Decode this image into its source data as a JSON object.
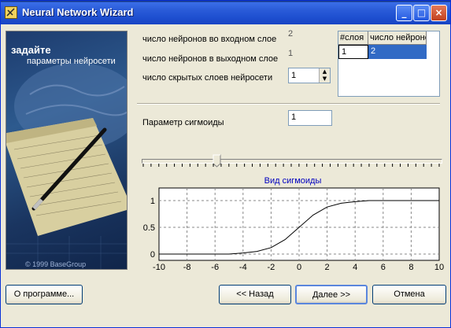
{
  "window": {
    "title": "Neural Network Wizard",
    "buttons": [
      "_",
      "□",
      "×"
    ]
  },
  "side_panel": {
    "heading": "задайте",
    "subheading": "параметры нейросети",
    "copyright": "© 1999 BaseGroup"
  },
  "params": {
    "input_label": "число нейронов во входном слое",
    "input_value": "2",
    "output_label": "число нейронов в выходном слое",
    "output_value": "1",
    "hidden_label": "число скрытых слоев нейросети",
    "hidden_value": "1"
  },
  "layers_table": {
    "headers": [
      "#слоя",
      "число нейроно"
    ],
    "rows": [
      [
        "1",
        "2"
      ]
    ]
  },
  "sigmoid": {
    "label": "Параметр сигмоиды",
    "value": "1"
  },
  "slider": {
    "tick_count": 38,
    "value_fraction": 0.25
  },
  "chart_data": {
    "type": "line",
    "title": "Вид сигмоиды",
    "xlim": [
      -10,
      10
    ],
    "ylim": [
      0,
      1
    ],
    "x_ticks": [
      "-10",
      "-8",
      "-6",
      "-4",
      "-2",
      "0",
      "2",
      "4",
      "6",
      "8",
      "10"
    ],
    "y_ticks": [
      "0",
      "0.5",
      "1"
    ],
    "grid": true,
    "series": [
      {
        "x": [
          -10,
          -8,
          -6,
          -5,
          -4,
          -3,
          -2,
          -1,
          0,
          1,
          2,
          3,
          4,
          5,
          6,
          8,
          10
        ],
        "y": [
          0.0,
          0.0,
          0.0,
          0.0,
          0.02,
          0.05,
          0.12,
          0.27,
          0.5,
          0.73,
          0.88,
          0.95,
          0.98,
          1.0,
          1.0,
          1.0,
          1.0
        ]
      }
    ]
  },
  "footer": {
    "about": "О программе...",
    "back": "<< Назад",
    "next": "Далее >>",
    "cancel": "Отмена"
  },
  "colors": {
    "title_blue": "#1e4fd0",
    "selection": "#316ac5",
    "chart_title": "#0000c0"
  }
}
